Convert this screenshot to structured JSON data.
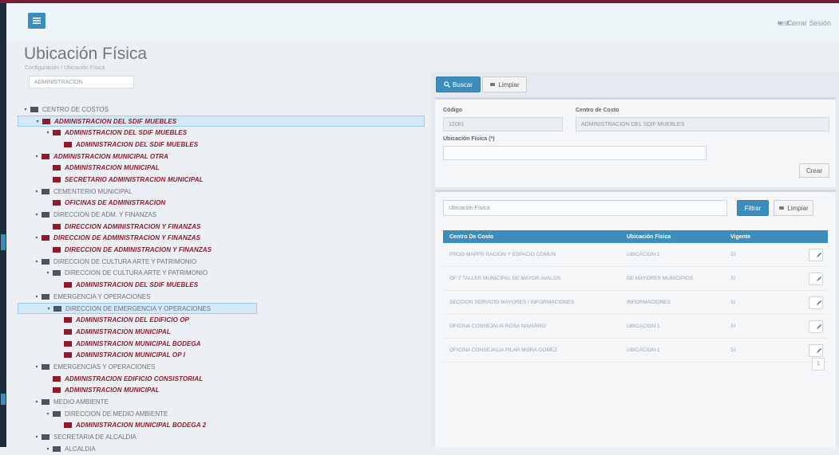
{
  "header": {
    "user_label": "test ...",
    "logout_label": "Cerrar Sesión",
    "menu_icon": "hamburger-icon",
    "logout_icon": "sign-out-icon"
  },
  "page": {
    "title": "Ubicación Física",
    "breadcrumb": "Configuración / Ubicación Física"
  },
  "tree": {
    "search_value": "ADMINISTRACION",
    "nodes": [
      {
        "label": "CENTRO DE COSTOS",
        "style": "plain"
      },
      {
        "label": "ADMINISTRACION DEL SDIF MUEBLES",
        "style": "red",
        "selected": true
      },
      {
        "label": "ADMINISTRACION DEL SDIF MUEBLES",
        "style": "red"
      },
      {
        "label": "ADMINISTRACION DEL SDIF MUEBLES",
        "style": "red"
      },
      {
        "label": "ADMINISTRACION MUNICIPAL OTRA",
        "style": "red"
      },
      {
        "label": "ADMINISTRACION MUNICIPAL",
        "style": "red"
      },
      {
        "label": "SECRETARIO ADMINISTRACION MUNICIPAL",
        "style": "red"
      },
      {
        "label": "CEMENTERIO MUNICIPAL",
        "style": "plain"
      },
      {
        "label": "OFICINAS DE ADMINISTRACION",
        "style": "red"
      },
      {
        "label": "DIRECCION DE ADM. Y FINANZAS",
        "style": "plain"
      },
      {
        "label": "DIRECCION ADMINISTRACION Y FINANZAS",
        "style": "red"
      },
      {
        "label": "DIRECCION DE ADMINISTRACION Y FINANZAS",
        "style": "red"
      },
      {
        "label": "DIRECCION DE ADMINISTRACION Y FINANZAS",
        "style": "red"
      },
      {
        "label": "DIRECCION DE CULTURA ARTE Y PATRIMONIO",
        "style": "plain"
      },
      {
        "label": "DIRECCION DE CULTURA ARTE Y PATRIMONIO",
        "style": "plain"
      },
      {
        "label": "ADMINISTRACION DEL SDIF MUEBLES",
        "style": "red"
      },
      {
        "label": "EMERGENCIA Y OPERACIONES",
        "style": "plain"
      },
      {
        "label": "DIRECCION DE EMERGENCIA Y OPERACIONES",
        "style": "plain",
        "selected": true
      },
      {
        "label": "ADMINISTRACION DEL EDIFICIO OP",
        "style": "red"
      },
      {
        "label": "ADMINISTRACION MUNICIPAL",
        "style": "red"
      },
      {
        "label": "ADMINISTRACION MUNICIPAL BODEGA",
        "style": "red"
      },
      {
        "label": "ADMINISTRACION MUNICIPAL OP I",
        "style": "red"
      },
      {
        "label": "EMERGENCIAS Y OPERACIONES",
        "style": "plain"
      },
      {
        "label": "ADMINISTRACION EDIFICIO CONSISTORIAL",
        "style": "red"
      },
      {
        "label": "ADMINISTRACION MUNICIPAL",
        "style": "red"
      },
      {
        "label": "MEDIO AMBIENTE",
        "style": "plain"
      },
      {
        "label": "DIRECCION DE MEDIO AMBIENTE",
        "style": "plain"
      },
      {
        "label": "ADMINISTRACION MUNICIPAL BODEGA 2",
        "style": "red"
      },
      {
        "label": "SECRETARIA DE ALCALDIA",
        "style": "plain"
      },
      {
        "label": "ALCALDIA",
        "style": "plain"
      }
    ]
  },
  "actions": {
    "search_label": "Buscar",
    "clear_label": "Limpiar"
  },
  "form": {
    "code_label": "Código",
    "code_value": "12061",
    "cost_center_label": "Centro de Costo",
    "cost_center_value": "ADMINISTRACION DEL SDIF MUEBLES",
    "location_label": "Ubicación Física (*)",
    "location_value": "",
    "create_label": "Crear"
  },
  "list": {
    "filter_placeholder": "Ubicación Física",
    "filter_button": "Filtrar",
    "clear_button": "Limpiar",
    "columns": [
      "Centro De Costo",
      "Ubicación Física",
      "Vigente",
      ""
    ],
    "rows": [
      [
        "PROG MAPFR RACION Y ESPACIO COMUN",
        "UBICACION 1",
        "SI"
      ],
      [
        "OF 7 TALLER MUNICIPAL DE MAYOR AVALOS",
        "DE MAYORES MUNICIPIOS",
        "SI"
      ],
      [
        "SECCION SERVICIO MAYORES / INFORMACIONES",
        "INFORMACIONES",
        "SI"
      ],
      [
        "OFICINA CONSEJALIA ROSA NAVARRO",
        "UBICACION 1",
        "SI"
      ],
      [
        "OFICINA CONSEJALIA PILAR MORA GOMEZ",
        "UBICACION 1",
        "SI"
      ]
    ],
    "pager_label": "1"
  }
}
